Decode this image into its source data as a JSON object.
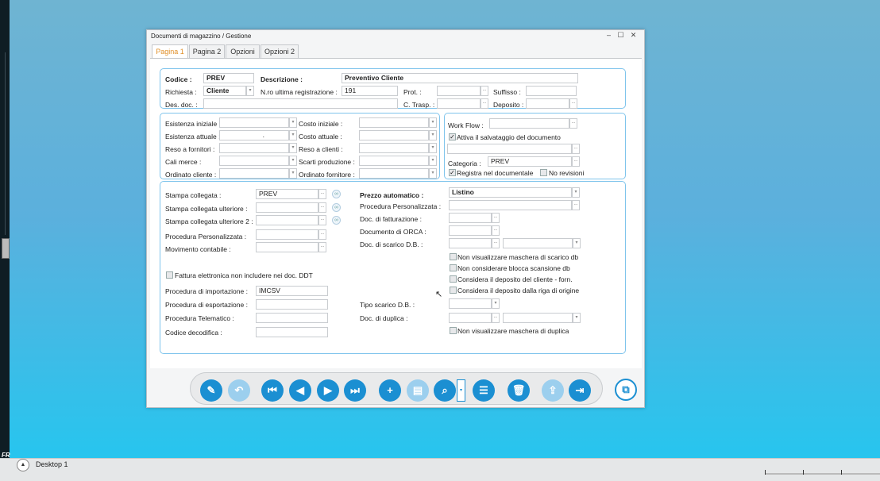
{
  "window": {
    "title": "Documenti di magazzino / Gestione",
    "minimize": "–",
    "restore": "☐",
    "close": "✕"
  },
  "tabs": [
    "Pagina 1",
    "Pagina 2",
    "Opzioni",
    "Opzioni 2"
  ],
  "header": {
    "codice_label": "Codice :",
    "codice_value": "PREV",
    "descrizione_label": "Descrizione :",
    "descrizione_value": "Preventivo Cliente",
    "richiesta_label": "Richiesta :",
    "richiesta_value": "Cliente",
    "nro_label": "N.ro ultima registrazione :",
    "nro_value": "191",
    "prot_label": "Prot. :",
    "suffisso_label": "Suffisso :",
    "desdoc_label": "Des. doc. :",
    "ctrasp_label": "C. Trasp. :",
    "deposito_label": "Deposito :"
  },
  "stock": {
    "esistenza_iniziale": "Esistenza iniziale :",
    "esistenza_attuale": "Esistenza attuale :",
    "reso_fornitori": "Reso a fornitori :",
    "cali_merce": "Cali merce :",
    "ordinato_cliente": "Ordinato cliente :",
    "costo_iniziale": "Costo iniziale :",
    "costo_attuale": "Costo attuale :",
    "reso_clienti": "Reso a clienti :",
    "scarti_produzione": "Scarti produzione :",
    "ordinato_fornitore": "Ordinato fornitore :",
    "dot": "."
  },
  "workflow": {
    "workflow_label": "Work Flow :",
    "attiva_label": "Attiva il salvataggio del documento",
    "categoria_label": "Categoria :",
    "categoria_value": "PREV",
    "registra_label": "Registra nel documentale",
    "norevisioni_label": "No revisioni"
  },
  "main": {
    "stampa_collegata": "Stampa collegata :",
    "stampa_collegata_value": "PREV",
    "stampa_ulteriore": "Stampa collegata ulteriore :",
    "stampa_ulteriore2": "Stampa collegata ulteriore 2 :",
    "procedura_pers": "Procedura Personalizzata :",
    "movimento_contabile": "Movimento contabile :",
    "fattura_label": "Fattura elettronica non includere nei doc. DDT",
    "proc_importazione": "Procedura di importazione :",
    "proc_importazione_value": "IMCSV",
    "proc_esportazione": "Procedura di esportazione :",
    "proc_telematico": "Procedura Telematico :",
    "codice_decodifica": "Codice decodifica :",
    "prezzo_automatico": "Prezzo automatico :",
    "prezzo_value": "Listino",
    "proc_pers_right": "Procedura Personalizzata :",
    "doc_fatturazione": "Doc. di fatturazione :",
    "doc_orca": "Documento di ORCA :",
    "doc_scarico": "Doc. di scarico D.B. :",
    "chk1": "Non visualizzare maschera di scarico db",
    "chk2": "Non considerare blocca scansione db",
    "chk3": "Considera il deposito del cliente - forn.",
    "chk4": "Considera il deposito dalla riga di origine",
    "tipo_scarico": "Tipo scarico D.B. :",
    "doc_duplica": "Doc. di duplica :",
    "chk5": "Non visualizzare maschera di duplica"
  },
  "taskbar": {
    "desktop_label": "Desktop 1",
    "fr": "FR"
  },
  "colors": {
    "accent": "#1b8fd2",
    "tab_active": "#e0902a",
    "group_border": "#7fc4ec"
  }
}
